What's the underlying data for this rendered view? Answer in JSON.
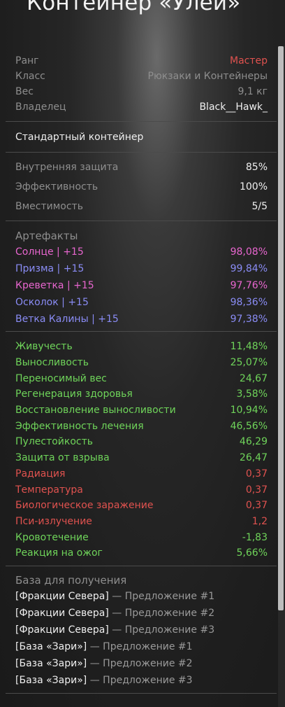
{
  "title": "Контейнер «Улей»",
  "info": [
    {
      "label": "Ранг",
      "value": "Мастер"
    },
    {
      "label": "Класс",
      "value": "Рюкзаки и Контейнеры"
    },
    {
      "label": "Вес",
      "value": "9,1 кг"
    },
    {
      "label": "Владелец",
      "value": "Black__Hawk_"
    }
  ],
  "type_label": "Стандартный контейнер",
  "stats": [
    {
      "label": "Внутренняя защита",
      "value": "85%"
    },
    {
      "label": "Эффективность",
      "value": "100%"
    },
    {
      "label": "Вместимость",
      "value": "5/5"
    }
  ],
  "artifacts_header": "Артефакты",
  "artifacts": [
    {
      "name": "Солнце | +15",
      "value": "98,08%"
    },
    {
      "name": "Призма | +15",
      "value": "99,84%"
    },
    {
      "name": "Креветка | +15",
      "value": "97,76%"
    },
    {
      "name": "Осколок | +15",
      "value": "98,36%"
    },
    {
      "name": "Ветка Калины | +15",
      "value": "97,38%"
    }
  ],
  "effects": [
    {
      "name": "Живучесть",
      "value": "11,48%"
    },
    {
      "name": "Выносливость",
      "value": "25,07%"
    },
    {
      "name": "Переносимый вес",
      "value": "24,67"
    },
    {
      "name": "Регенерация здоровья",
      "value": "3,58%"
    },
    {
      "name": "Восстановление выносливости",
      "value": "10,94%"
    },
    {
      "name": "Эффективность лечения",
      "value": "46,56%"
    },
    {
      "name": "Пулестойкость",
      "value": "46,29"
    },
    {
      "name": "Защита от взрыва",
      "value": "26,47"
    },
    {
      "name": "Радиация",
      "value": "0,37"
    },
    {
      "name": "Температура",
      "value": "0,37"
    },
    {
      "name": "Биологическое заражение",
      "value": "0,37"
    },
    {
      "name": "Пси-излучение",
      "value": "1,2"
    },
    {
      "name": "Кровотечение",
      "value": "-1,83"
    },
    {
      "name": "Реакция на ожог",
      "value": "5,66%"
    }
  ],
  "sources_header": "База для получения",
  "sources": [
    {
      "base": "[Фракции Севера]",
      "offer": " — Предложение #1"
    },
    {
      "base": "[Фракции Севера]",
      "offer": " — Предложение #2"
    },
    {
      "base": "[Фракции Севера]",
      "offer": " — Предложение #3"
    },
    {
      "base": "[База «Зари»]",
      "offer": " — Предложение #1"
    },
    {
      "base": "[База «Зари»]",
      "offer": " — Предложение #2"
    },
    {
      "base": "[База «Зари»]",
      "offer": " — Предложение #3"
    }
  ],
  "colors": {
    "rank": "#e0524f",
    "positive": "#6fd45a",
    "negative": "#e0524f",
    "artifact_pink": "#e866cf",
    "artifact_blue": "#8a8cf5"
  }
}
